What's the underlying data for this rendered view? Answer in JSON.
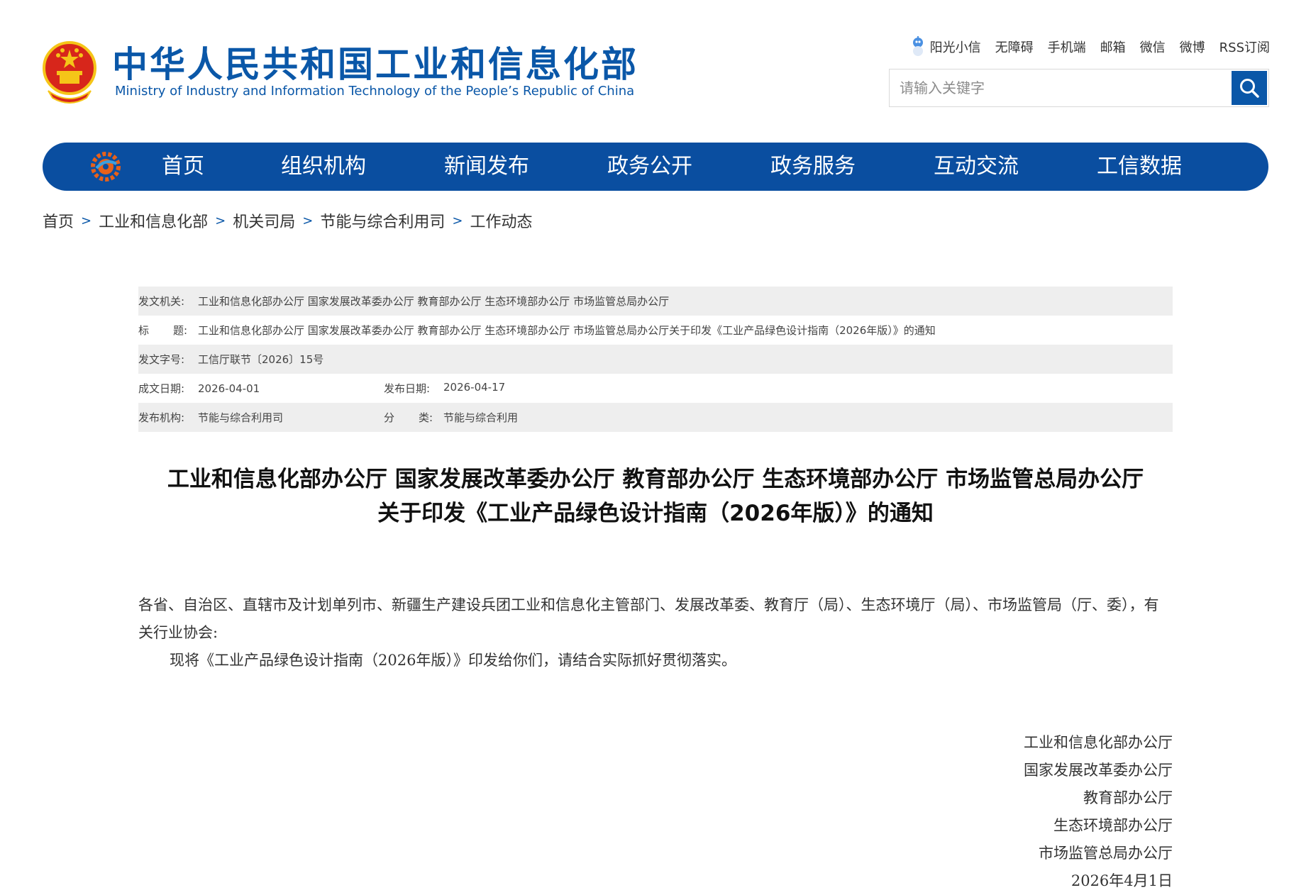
{
  "header": {
    "title_cn": "中华人民共和国工业和信息化部",
    "title_en": "Ministry of Industry and Information Technology of the People’s Republic of China",
    "top_links": [
      "阳光小信",
      "无障碍",
      "手机端",
      "邮箱",
      "微信",
      "微博",
      "RSS订阅"
    ],
    "search_placeholder": "请输入关键字"
  },
  "nav": {
    "items": [
      "首页",
      "组织机构",
      "新闻发布",
      "政务公开",
      "政务服务",
      "互动交流",
      "工信数据"
    ]
  },
  "breadcrumb": [
    "首页",
    "工业和信息化部",
    "机关司局",
    "节能与综合利用司",
    "工作动态"
  ],
  "meta": {
    "issuer_label": "发文机关:",
    "issuer": "工业和信息化部办公厅 国家发展改革委办公厅 教育部办公厅 生态环境部办公厅 市场监管总局办公厅",
    "title_label_1": "标",
    "title_label_2": "题:",
    "title": "工业和信息化部办公厅 国家发展改革委办公厅 教育部办公厅 生态环境部办公厅 市场监管总局办公厅关于印发《工业产品绿色设计指南（2026年版）》的通知",
    "doc_no_label": "发文字号:",
    "doc_no": "工信厅联节〔2026〕15号",
    "created_label": "成文日期:",
    "created": "2026-04-01",
    "published_label": "发布日期:",
    "published": "2026-04-17",
    "agency_label": "发布机构:",
    "agency": "节能与综合利用司",
    "category_label_1": "分",
    "category_label_2": "类:",
    "category": "节能与综合利用"
  },
  "article": {
    "title_line1": "工业和信息化部办公厅 国家发展改革委办公厅 教育部办公厅 生态环境部办公厅 市场监管总局办公厅",
    "title_line2": "关于印发《工业产品绿色设计指南（2026年版）》的通知",
    "salutation": "各省、自治区、直辖市及计划单列市、新疆生产建设兵团工业和信息化主管部门、发展改革委、教育厅（局）、生态环境厅（局）、市场监管局（厅、委），有关行业协会:",
    "body": "现将《工业产品绿色设计指南（2026年版）》印发给你们，请结合实际抓好贯彻落实。",
    "signoff": [
      "工业和信息化部办公厅",
      "国家发展改革委办公厅",
      "教育部办公厅",
      "生态环境部办公厅",
      "市场监管总局办公厅",
      "2026年4月1日"
    ]
  },
  "colors": {
    "brand_blue": "#0a57a8",
    "nav_blue": "#0a4ea0",
    "emblem_red": "#d7261b",
    "emblem_gold": "#f5c518",
    "meta_shade": "#eeeeee"
  },
  "icons": {
    "emblem": "national-emblem",
    "top_links_0": "robot-mascot-icon",
    "search": "search-icon",
    "nav_logo": "miit-gear-logo-icon"
  }
}
